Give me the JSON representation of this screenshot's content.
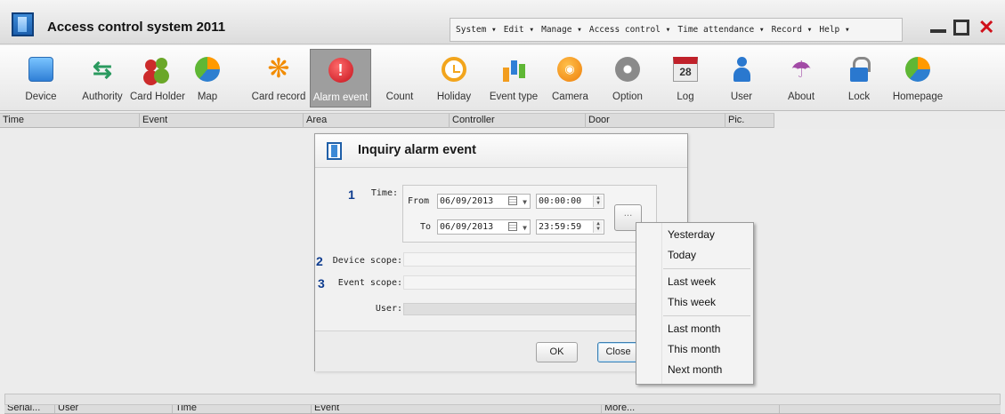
{
  "app": {
    "title": "Access control system 2011"
  },
  "menu": [
    "System ▾",
    "Edit ▾",
    "Manage ▾",
    "Access control ▾",
    "Time attendance ▾",
    "Record ▾",
    "Help ▾"
  ],
  "toolbar": [
    {
      "label": "Device",
      "icon": "device-icon"
    },
    {
      "label": "Authority",
      "icon": "authority-icon"
    },
    {
      "label": "Card Holder",
      "icon": "card-holder-icon"
    },
    {
      "label": "Map",
      "icon": "map-icon"
    },
    {
      "label": "Card record",
      "icon": "card-record-icon"
    },
    {
      "label": "Alarm event",
      "icon": "alarm-event-icon",
      "active": true
    },
    {
      "label": "Count",
      "icon": "count-icon"
    },
    {
      "label": "Holiday",
      "icon": "holiday-icon"
    },
    {
      "label": "Event type",
      "icon": "event-type-icon"
    },
    {
      "label": "Camera",
      "icon": "camera-icon"
    },
    {
      "label": "Option",
      "icon": "option-icon"
    },
    {
      "label": "Log",
      "icon": "log-icon",
      "icon_text": "28"
    },
    {
      "label": "User",
      "icon": "user-icon"
    },
    {
      "label": "About",
      "icon": "about-icon"
    },
    {
      "label": "Lock",
      "icon": "lock-icon"
    },
    {
      "label": "Homepage",
      "icon": "homepage-icon"
    }
  ],
  "grid": {
    "columns": [
      "Time",
      "Event",
      "Area",
      "Controller",
      "Door",
      "Pic."
    ]
  },
  "bottom_grid": {
    "columns": [
      "Serial...",
      "User",
      "Time",
      "Event",
      "More..."
    ]
  },
  "dialog": {
    "title": "Inquiry alarm event",
    "steps": [
      "1",
      "2",
      "3"
    ],
    "time_label": "Time:",
    "from_label": "From",
    "to_label": "To",
    "from_date": "06/09/2013",
    "from_time": "00:00:00",
    "to_date": "06/09/2013",
    "to_time": "23:59:59",
    "more_button": "...",
    "device_scope_label": "Device scope:",
    "event_scope_label": "Event scope:",
    "user_label": "User:",
    "ok_button": "OK",
    "close_button": "Close"
  },
  "popup": {
    "groups": [
      [
        "Yesterday",
        "Today"
      ],
      [
        "Last week",
        "This week"
      ],
      [
        "Last month",
        "This month",
        "Next month"
      ]
    ]
  },
  "colors": {
    "active_tool": "#9e9e9e",
    "close_icon": "#d0101a",
    "step_number": "#0f3d8f"
  }
}
